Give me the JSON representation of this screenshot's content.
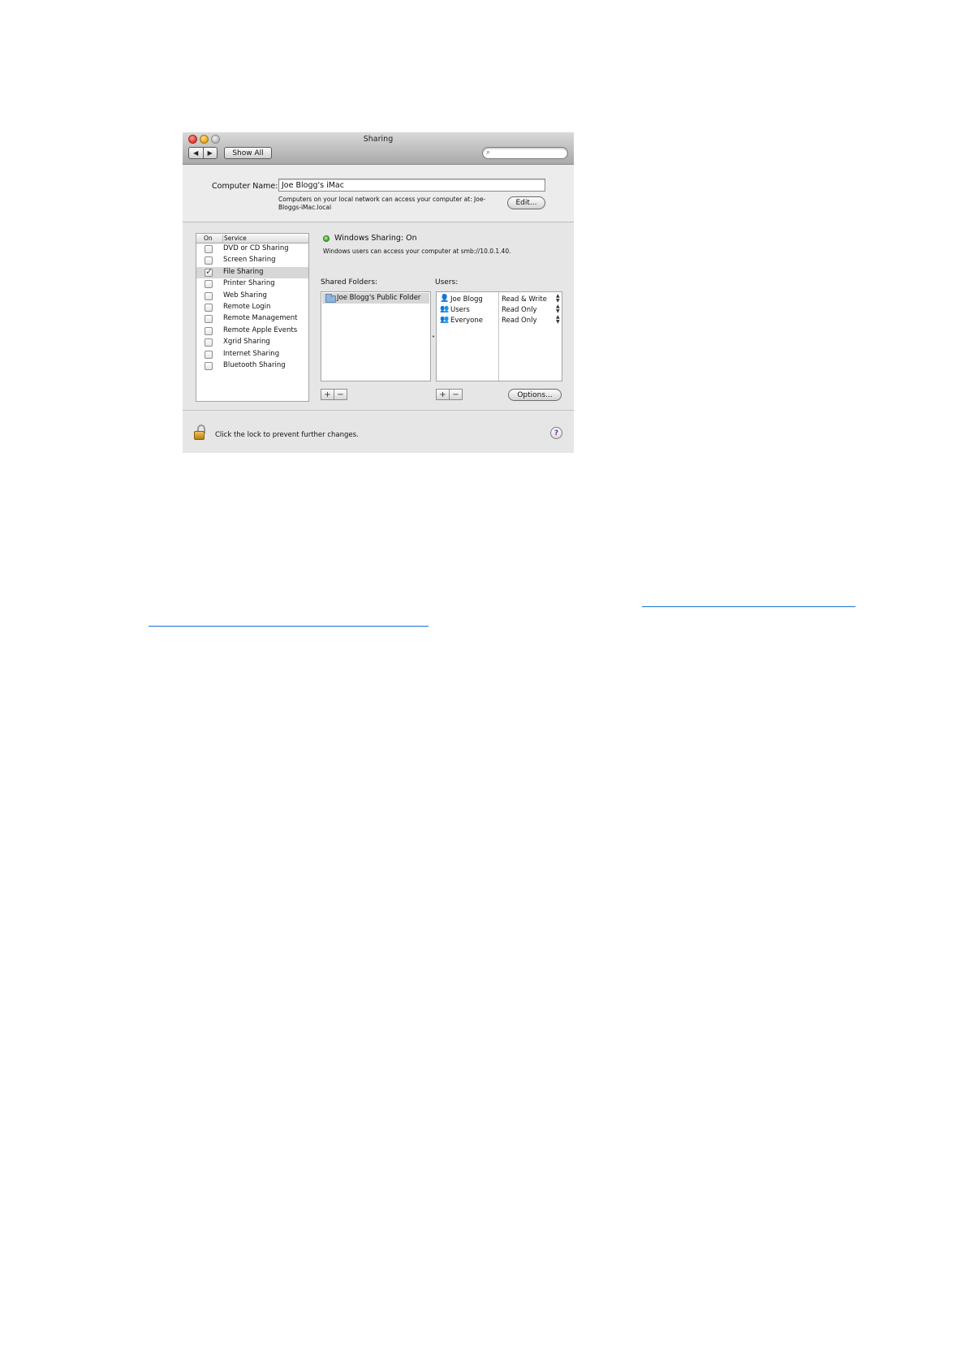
{
  "window": {
    "title": "Sharing",
    "nav_back": "◀",
    "nav_forward": "▶",
    "show_all": "Show All",
    "search_placeholder": ""
  },
  "computer_name": {
    "label": "Computer Name:",
    "value": "Joe Blogg's iMac",
    "note": "Computers on your local network can access your computer at: Joe-Bloggs-iMac.local",
    "edit_button": "Edit..."
  },
  "services": {
    "header_on": "On",
    "header_service": "Service",
    "items": [
      {
        "label": "DVD or CD Sharing",
        "checked": false,
        "selected": false
      },
      {
        "label": "Screen Sharing",
        "checked": false,
        "selected": false
      },
      {
        "label": "File Sharing",
        "checked": true,
        "selected": true
      },
      {
        "label": "Printer Sharing",
        "checked": false,
        "selected": false
      },
      {
        "label": "Web Sharing",
        "checked": false,
        "selected": false
      },
      {
        "label": "Remote Login",
        "checked": false,
        "selected": false
      },
      {
        "label": "Remote Management",
        "checked": false,
        "selected": false
      },
      {
        "label": "Remote Apple Events",
        "checked": false,
        "selected": false
      },
      {
        "label": "Xgrid Sharing",
        "checked": false,
        "selected": false
      },
      {
        "label": "Internet Sharing",
        "checked": false,
        "selected": false
      },
      {
        "label": "Bluetooth Sharing",
        "checked": false,
        "selected": false
      }
    ]
  },
  "status": {
    "title": "Windows Sharing: On",
    "description": "Windows users can access your computer at smb://10.0.1.40.",
    "color": "#3da82a"
  },
  "shared_folders": {
    "label": "Shared Folders:",
    "items": [
      "Joe Blogg's Public Folder"
    ]
  },
  "users": {
    "label": "Users:",
    "items": [
      {
        "icon": "user-icon",
        "name": "Joe Blogg",
        "permission": "Read & Write"
      },
      {
        "icon": "group-icon",
        "name": "Users",
        "permission": "Read Only"
      },
      {
        "icon": "everyone-icon",
        "name": "Everyone",
        "permission": "Read Only"
      }
    ]
  },
  "controls": {
    "plus": "+",
    "minus": "−",
    "options_button": "Options..."
  },
  "footer": {
    "lock_text": "Click the lock to prevent further changes.",
    "help": "?"
  }
}
